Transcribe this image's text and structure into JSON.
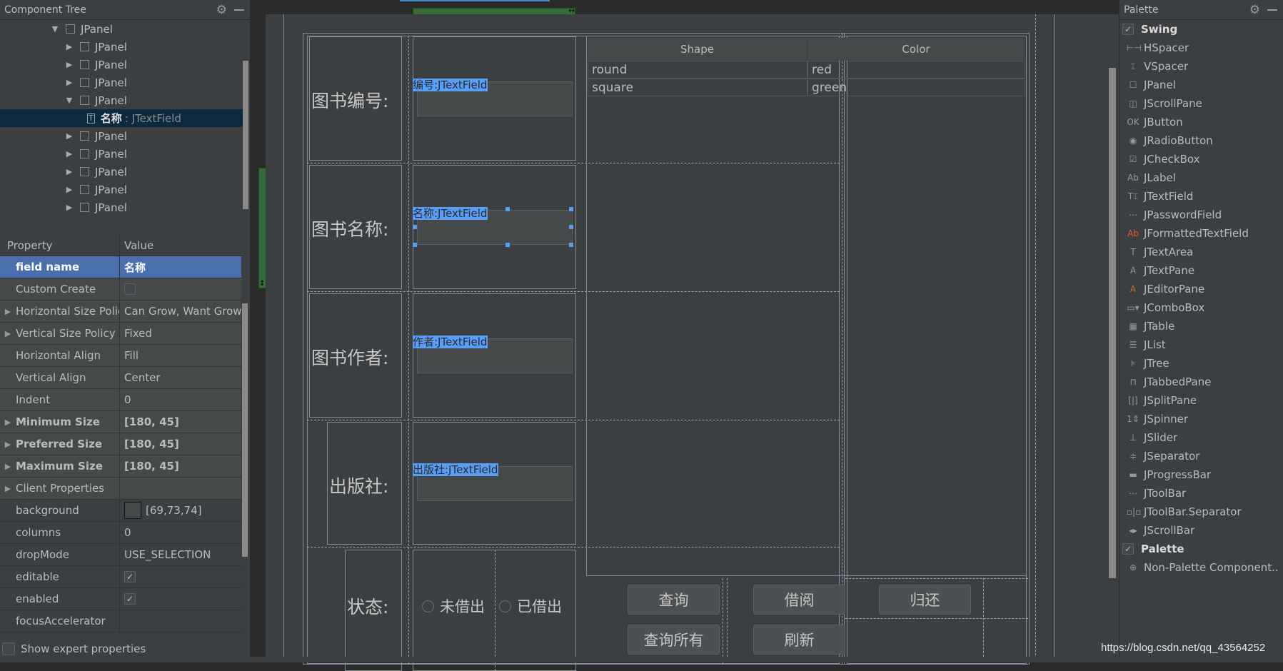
{
  "component_tree": {
    "title": "Component Tree",
    "nodes": [
      {
        "label": "JPanel",
        "expanded": true,
        "level": 0
      },
      {
        "label": "JPanel",
        "expanded": false,
        "level": 1
      },
      {
        "label": "JPanel",
        "expanded": false,
        "level": 1
      },
      {
        "label": "JPanel",
        "expanded": false,
        "level": 1
      },
      {
        "label": "JPanel",
        "expanded": true,
        "level": 1
      },
      {
        "label": "名称",
        "type": ": JTextField",
        "level": 2,
        "selected": true
      },
      {
        "label": "JPanel",
        "expanded": false,
        "level": 1
      },
      {
        "label": "JPanel",
        "expanded": false,
        "level": 1
      },
      {
        "label": "JPanel",
        "expanded": false,
        "level": 1
      },
      {
        "label": "JPanel",
        "expanded": false,
        "level": 1
      },
      {
        "label": "JPanel",
        "expanded": false,
        "level": 1
      }
    ]
  },
  "properties": {
    "header": {
      "property": "Property",
      "value": "Value"
    },
    "rows": [
      {
        "name": "field name",
        "value": "名称",
        "bold": true,
        "selected": true
      },
      {
        "name": "Custom Create",
        "value": "",
        "checkbox": false
      },
      {
        "name": "Horizontal Size Polic",
        "value": "Can Grow, Want Grow",
        "expandable": true
      },
      {
        "name": "Vertical Size Policy",
        "value": "Fixed",
        "expandable": true
      },
      {
        "name": "Horizontal Align",
        "value": "Fill"
      },
      {
        "name": "Vertical Align",
        "value": "Center"
      },
      {
        "name": "Indent",
        "value": "0"
      },
      {
        "name": "Minimum Size",
        "value": "[180, 45]",
        "bold": true,
        "expandable": true
      },
      {
        "name": "Preferred Size",
        "value": "[180, 45]",
        "bold": true,
        "expandable": true
      },
      {
        "name": "Maximum Size",
        "value": "[180, 45]",
        "bold": true,
        "expandable": true
      },
      {
        "name": "Client Properties",
        "value": "",
        "expandable": true
      },
      {
        "name": "background",
        "value": "[69,73,74]",
        "swatch": "#45494a"
      },
      {
        "name": "columns",
        "value": "0"
      },
      {
        "name": "dropMode",
        "value": "USE_SELECTION"
      },
      {
        "name": "editable",
        "value": "",
        "checkbox": true
      },
      {
        "name": "enabled",
        "value": "",
        "checkbox": true
      },
      {
        "name": "focusAccelerator",
        "value": ""
      }
    ],
    "show_expert": "Show expert properties"
  },
  "form": {
    "labels": [
      "图书编号:",
      "图书名称:",
      "图书作者:",
      "出版社:",
      "状态:"
    ],
    "fields": [
      {
        "tag": "编号:JTextField"
      },
      {
        "tag": "名称:JTextField",
        "selected": true
      },
      {
        "tag": "作者:JTextField"
      },
      {
        "tag": "出版社:JTextField"
      }
    ],
    "radios": [
      "未借出",
      "已借出"
    ],
    "table": {
      "columns": [
        "Shape",
        "Color"
      ],
      "rows": [
        [
          "round",
          "red"
        ],
        [
          "square",
          "green"
        ]
      ]
    },
    "buttons": [
      "查询",
      "借阅",
      "归还",
      "查询所有",
      "刷新"
    ]
  },
  "palette": {
    "title": "Palette",
    "groups": [
      {
        "name": "Swing",
        "checked": true,
        "items": [
          {
            "label": "HSpacer",
            "icon": "hspacer-icon",
            "glyph": "⊢⊣"
          },
          {
            "label": "VSpacer",
            "icon": "vspacer-icon",
            "glyph": "⌶"
          },
          {
            "label": "JPanel",
            "icon": "panel-icon",
            "glyph": "☐"
          },
          {
            "label": "JScrollPane",
            "icon": "scrollpane-icon",
            "glyph": "◫"
          },
          {
            "label": "JButton",
            "icon": "button-icon",
            "glyph": "OK"
          },
          {
            "label": "JRadioButton",
            "icon": "radio-icon",
            "glyph": "◉"
          },
          {
            "label": "JCheckBox",
            "icon": "checkbox-icon",
            "glyph": "☑"
          },
          {
            "label": "JLabel",
            "icon": "label-icon",
            "glyph": "Ab"
          },
          {
            "label": "JTextField",
            "icon": "textfield-icon",
            "glyph": "T⌶"
          },
          {
            "label": "JPasswordField",
            "icon": "passwordfield-icon",
            "glyph": "⋯"
          },
          {
            "label": "JFormattedTextField",
            "icon": "formattedtextfield-icon",
            "glyph": "Ab",
            "orange": true
          },
          {
            "label": "JTextArea",
            "icon": "textarea-icon",
            "glyph": "T"
          },
          {
            "label": "JTextPane",
            "icon": "textpane-icon",
            "glyph": "A"
          },
          {
            "label": "JEditorPane",
            "icon": "editorpane-icon",
            "glyph": "A",
            "orange": true
          },
          {
            "label": "JComboBox",
            "icon": "combobox-icon",
            "glyph": "▭▾"
          },
          {
            "label": "JTable",
            "icon": "table-icon",
            "glyph": "▦"
          },
          {
            "label": "JList",
            "icon": "list-icon",
            "glyph": "☰"
          },
          {
            "label": "JTree",
            "icon": "tree-icon",
            "glyph": "⊧"
          },
          {
            "label": "JTabbedPane",
            "icon": "tabbedpane-icon",
            "glyph": "⊓"
          },
          {
            "label": "JSplitPane",
            "icon": "splitpane-icon",
            "glyph": "[|]"
          },
          {
            "label": "JSpinner",
            "icon": "spinner-icon",
            "glyph": "1⇕"
          },
          {
            "label": "JSlider",
            "icon": "slider-icon",
            "glyph": "⊥"
          },
          {
            "label": "JSeparator",
            "icon": "separator-icon",
            "glyph": "≑"
          },
          {
            "label": "JProgressBar",
            "icon": "progressbar-icon",
            "glyph": "▬"
          },
          {
            "label": "JToolBar",
            "icon": "toolbar-icon",
            "glyph": "⋯"
          },
          {
            "label": "JToolBar.Separator",
            "icon": "toolbar-separator-icon",
            "glyph": "▫|▫"
          },
          {
            "label": "JScrollBar",
            "icon": "scrollbar-icon",
            "glyph": "◂▸"
          }
        ]
      },
      {
        "name": "Palette",
        "checked": true,
        "items": [
          {
            "label": "Non-Palette Component..",
            "icon": "non-palette-component-icon",
            "glyph": "⊕"
          }
        ]
      }
    ]
  },
  "watermark": "https://blog.csdn.net/qq_43564252",
  "icons": {
    "gear": "⚙",
    "expand": "▶",
    "collapse": "▼",
    "check": "✓",
    "resize_h": "↔",
    "resize_v": "↕"
  }
}
